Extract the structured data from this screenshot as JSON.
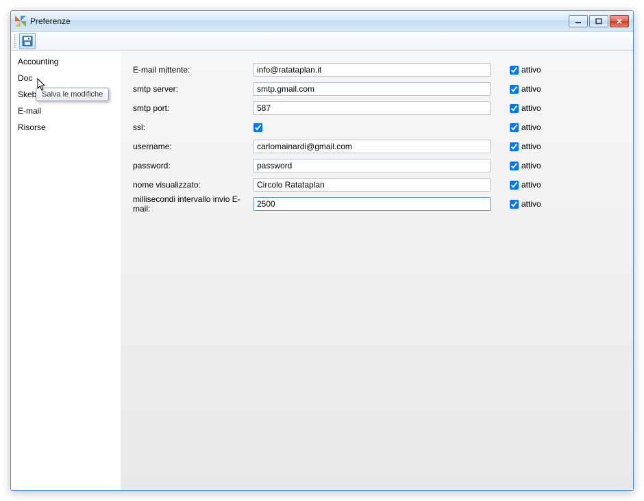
{
  "window": {
    "title": "Preferenze"
  },
  "toolbar": {
    "save_tooltip": "Salva le modifiche"
  },
  "sidebar": {
    "items": [
      {
        "label": "Accounting"
      },
      {
        "label": "Doc"
      },
      {
        "label": "Skebby"
      },
      {
        "label": "E-mail"
      },
      {
        "label": "Risorse"
      }
    ]
  },
  "form": {
    "rows": [
      {
        "label": "E-mail mittente:",
        "value": "info@ratataplan.it",
        "type": "text",
        "attivo": true,
        "attivo_label": "attivo"
      },
      {
        "label": "smtp server:",
        "value": "smtp.gmail.com",
        "type": "text",
        "attivo": true,
        "attivo_label": "attivo"
      },
      {
        "label": "smtp port:",
        "value": "587",
        "type": "text",
        "attivo": true,
        "attivo_label": "attivo"
      },
      {
        "label": "ssl:",
        "value": "",
        "type": "check",
        "checked": true,
        "attivo": true,
        "attivo_label": "attivo"
      },
      {
        "label": "username:",
        "value": "carlomainardi@gmail.com",
        "type": "text",
        "attivo": true,
        "attivo_label": "attivo"
      },
      {
        "label": "password:",
        "value": "password",
        "type": "text",
        "attivo": true,
        "attivo_label": "attivo"
      },
      {
        "label": "nome visualizzato:",
        "value": "Circolo Ratataplan",
        "type": "text",
        "attivo": true,
        "attivo_label": "attivo"
      },
      {
        "label": "millisecondi intervallo invio E-mail:",
        "value": "2500",
        "type": "text",
        "attivo": true,
        "attivo_label": "attivo",
        "selected": true
      }
    ]
  }
}
